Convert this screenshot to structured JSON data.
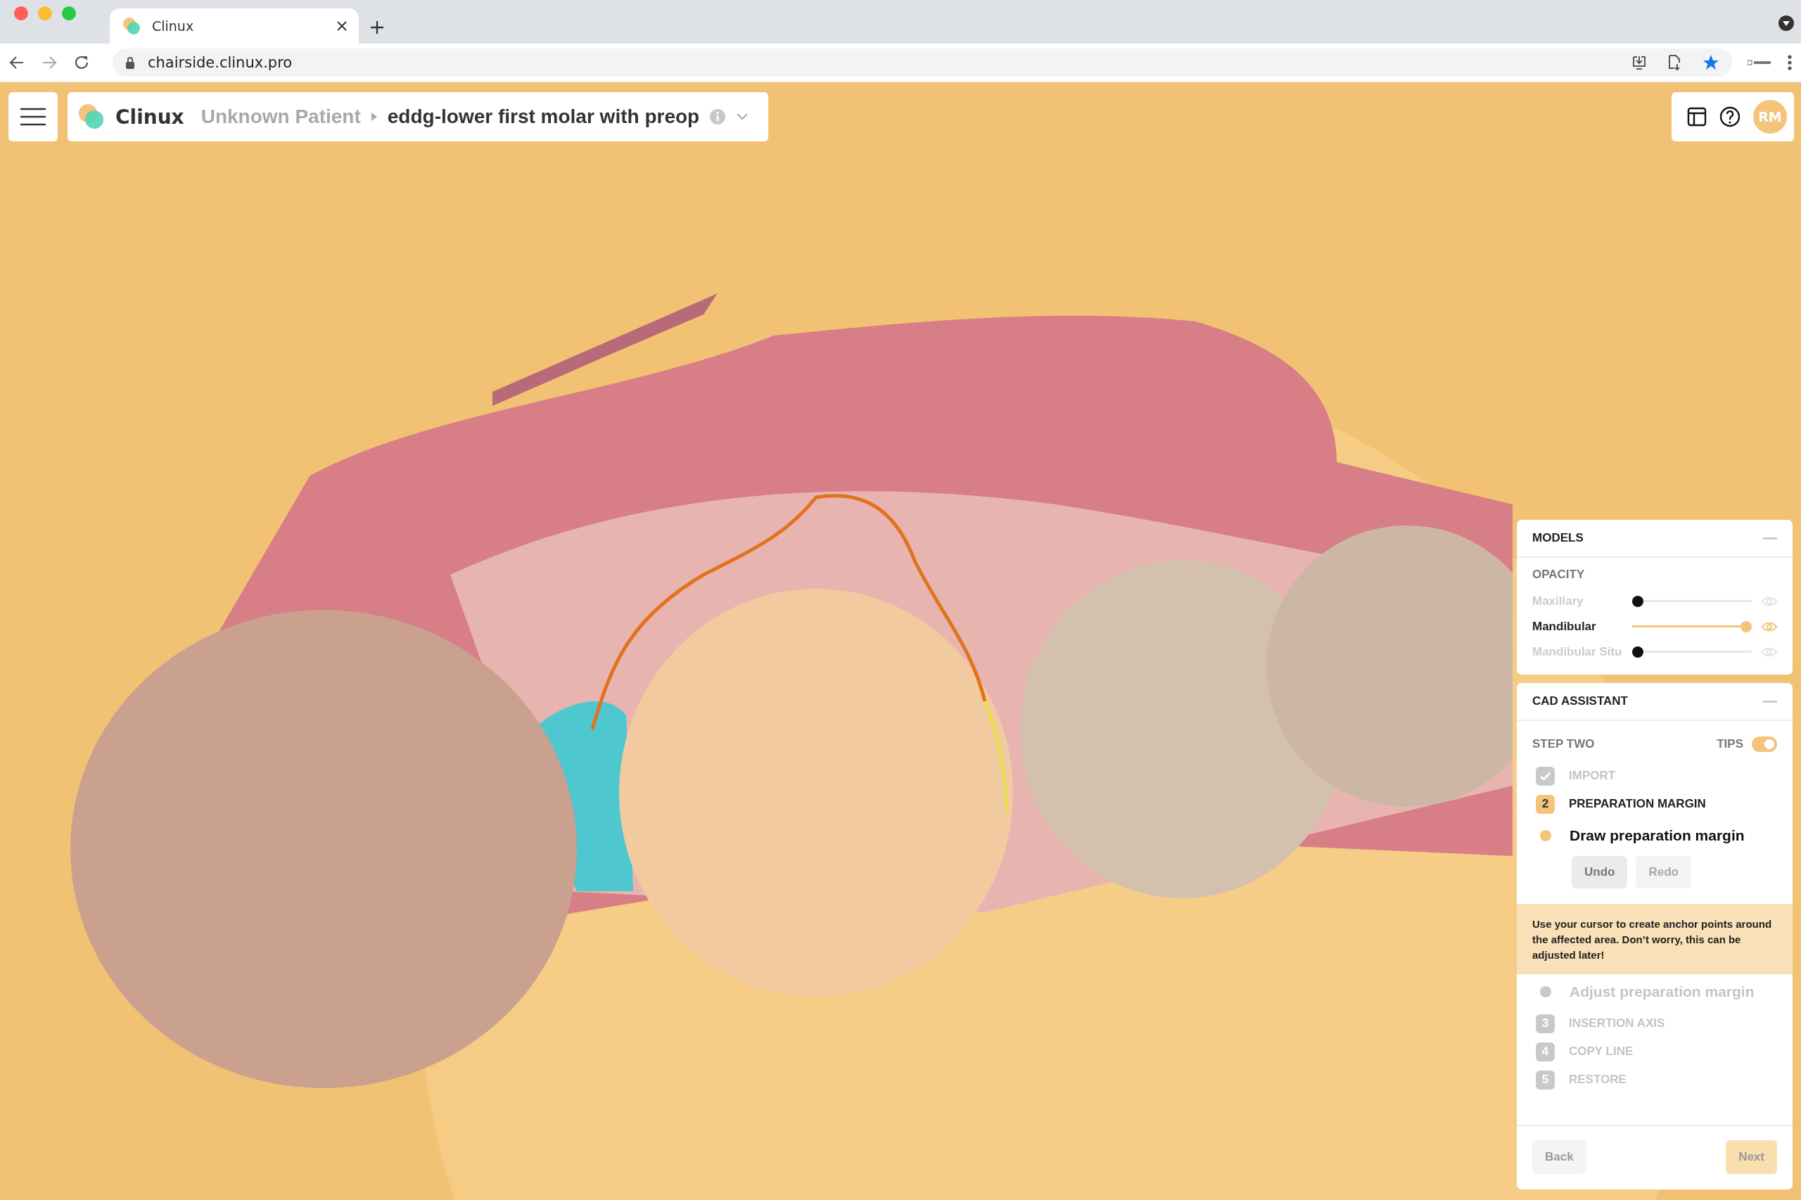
{
  "browser": {
    "tab_title": "Clinux",
    "url": "chairside.clinux.pro"
  },
  "header": {
    "brand": "Clinux",
    "patient": "Unknown Patient",
    "case_name": "eddg-lower first molar with preop",
    "avatar_initials": "RM"
  },
  "models": {
    "title": "MODELS",
    "section": "OPACITY",
    "items": [
      {
        "name": "Maxillary",
        "active": false,
        "level": 0
      },
      {
        "name": "Mandibular",
        "active": true,
        "level": 1
      },
      {
        "name": "Mandibular Situ",
        "active": false,
        "level": 0
      }
    ]
  },
  "cad_assistant": {
    "title": "CAD ASSISTANT",
    "step_label": "STEP TWO",
    "tips_label": "TIPS",
    "tips_on": true,
    "steps": [
      {
        "label": "IMPORT",
        "done": true,
        "current": false
      },
      {
        "number": "2",
        "label": "PREPARATION MARGIN",
        "done": false,
        "current": true,
        "children": [
          {
            "label": "Draw preparation margin",
            "current": true,
            "actions": [
              {
                "label": "Undo",
                "disabled": false
              },
              {
                "label": "Redo",
                "disabled": true
              }
            ],
            "tip": "Use your cursor to create anchor points around the affected area. Don’t worry, this can be adjusted later!"
          },
          {
            "label": "Adjust preparation margin",
            "current": false
          }
        ]
      },
      {
        "number": "3",
        "label": "INSERTION AXIS",
        "done": false,
        "current": false
      },
      {
        "number": "4",
        "label": "COPY LINE",
        "done": false,
        "current": false
      },
      {
        "number": "5",
        "label": "RESTORE",
        "done": false,
        "current": false
      }
    ],
    "buttons": [
      {
        "label": "Back",
        "kind": "secondary"
      },
      {
        "label": "Next",
        "kind": "primary"
      }
    ]
  }
}
